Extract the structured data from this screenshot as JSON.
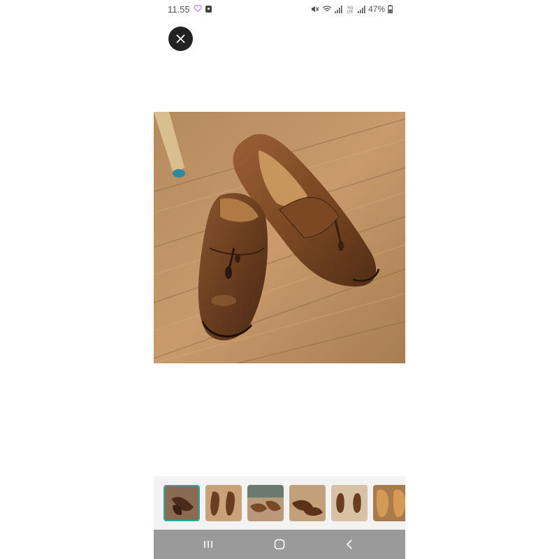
{
  "status_bar": {
    "time": "11.55",
    "battery": "47%",
    "icons": [
      "heart-icon",
      "notification-icon",
      "mute-icon",
      "wifi-icon",
      "signal-icon",
      "volte-icon",
      "signal-icon",
      "battery-icon"
    ],
    "volte_label": "Vo))\nLTE"
  },
  "viewer": {
    "close_icon": "close-icon",
    "main_image": "brown leather tassel loafers on wooden floor",
    "thumbnails_count": 6,
    "selected_thumbnail": 1
  },
  "nav_bar": {
    "recents_icon": "recents-icon",
    "home_icon": "home-icon",
    "back_icon": "back-icon"
  },
  "colors": {
    "accent": "#26aa99",
    "nav_bg": "#9a9a9a",
    "close_bg": "#222222"
  }
}
